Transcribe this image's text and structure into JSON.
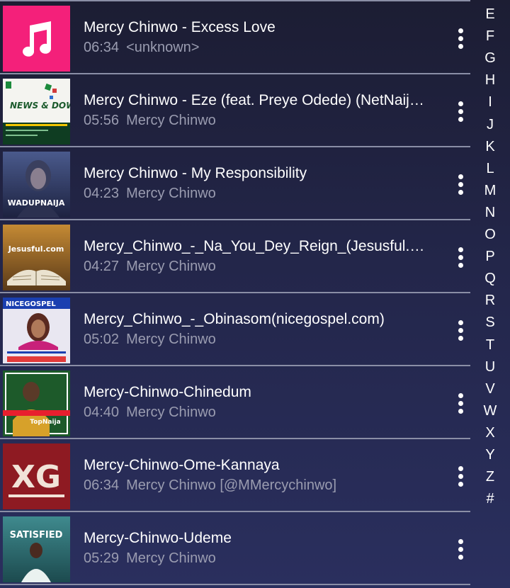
{
  "songs": [
    {
      "title": "Mercy Chinwo - Excess Love",
      "duration": "06:34",
      "artist": "<unknown>",
      "art": "music-note-icon"
    },
    {
      "title": "Mercy Chinwo - Eze (feat. Preye Odede) (NetNaija.c...",
      "duration": "05:56",
      "artist": "Mercy Chinwo",
      "art": "news-downloads-cover",
      "art_text": "NEWS & DOWNLOADS"
    },
    {
      "title": "Mercy Chinwo - My Responsibility",
      "duration": "04:23",
      "artist": "Mercy Chinwo",
      "art": "wadupnaija-cover",
      "art_text": "WADUPNAIJA"
    },
    {
      "title": "Mercy_Chinwo_-_Na_You_Dey_Reign_(Jesusful.co...",
      "duration": "04:27",
      "artist": "Mercy Chinwo",
      "art": "jesusful-cover",
      "art_text": "Jesusful.com"
    },
    {
      "title": "Mercy_Chinwo_-_Obinasom(nicegospel.com)",
      "duration": "05:02",
      "artist": "Mercy Chinwo",
      "art": "nicegospel-cover",
      "art_text": "NICEGOSPEL"
    },
    {
      "title": "Mercy-Chinwo-Chinedum",
      "duration": "04:40",
      "artist": "Mercy Chinwo",
      "art": "topnaija-cover",
      "art_text": "TopNaija"
    },
    {
      "title": "Mercy-Chinwo-Ome-Kannaya",
      "duration": "06:34",
      "artist": "Mercy Chinwo [@MMercychinwo]",
      "art": "xclusivegospel-cover",
      "art_text": "XG"
    },
    {
      "title": "Mercy-Chinwo-Udeme",
      "duration": "05:29",
      "artist": "Mercy Chinwo",
      "art": "satisfied-cover",
      "art_text": "SATISFIED"
    }
  ],
  "alphabet": [
    "E",
    "F",
    "G",
    "H",
    "I",
    "J",
    "K",
    "L",
    "M",
    "N",
    "O",
    "P",
    "Q",
    "R",
    "S",
    "T",
    "U",
    "V",
    "W",
    "X",
    "Y",
    "Z",
    "#"
  ],
  "colors": {
    "accent_pink": "#f4207a",
    "text_primary": "#ffffff",
    "text_secondary": "#9a9cb0"
  }
}
